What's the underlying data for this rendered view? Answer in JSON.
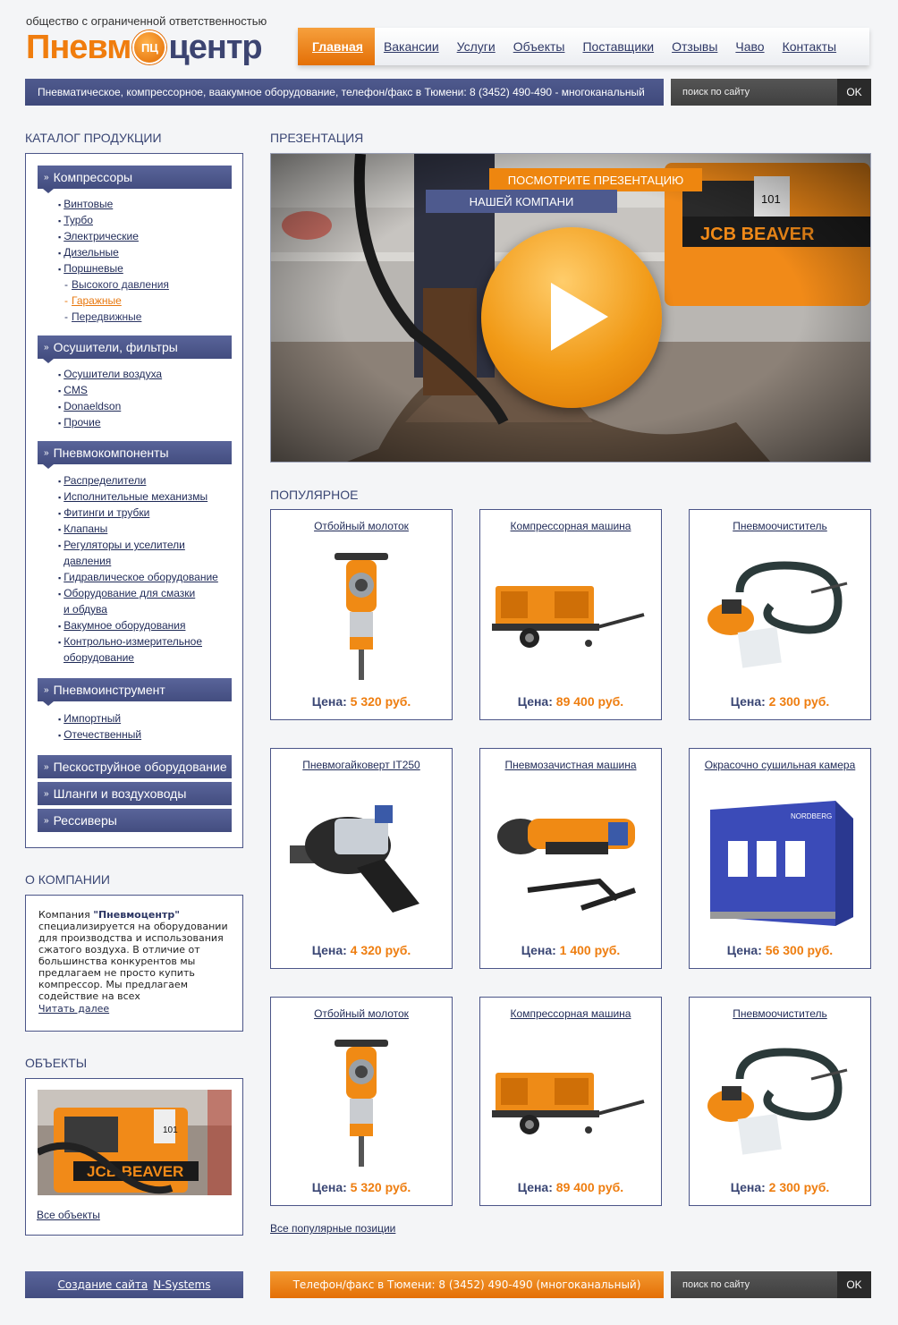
{
  "header": {
    "tagline": "общество с ограниченной ответственностью",
    "logo_left": "Пневм",
    "logo_mark": "ПЦ",
    "logo_right": "центр"
  },
  "nav": {
    "items": [
      "Главная",
      "Вакансии",
      "Услуги",
      "Объекты",
      "Поставщики",
      "Отзывы",
      "Чаво",
      "Контакты"
    ],
    "active": "Главная"
  },
  "infobar": "Пневматическое, компрессорное, ваакумное оборудование, телефон/факс в Тюмени: 8 (3452) 490-490 - многоканальный",
  "search": {
    "placeholder": "поиск по сайту",
    "button": "OK"
  },
  "catalog": {
    "title": "КАТАЛОГ ПРОДУКЦИИ",
    "groups": [
      {
        "label": "Компрессоры",
        "items": [
          "Винтовые",
          "Турбо",
          "Электрические",
          "Дизельные",
          "Поршневые"
        ],
        "subitems": [
          "Высокого давления",
          "Гаражные",
          "Передвижные"
        ]
      },
      {
        "label": "Осушители, фильтры",
        "items": [
          "Осушители воздуха",
          "CMS",
          "Donaeldson",
          "Прочие"
        ]
      },
      {
        "label": "Пневмокомпоненты",
        "items": [
          "Распределители",
          "Исполнительные механизмы",
          "Фитинги и трубки",
          "Клапаны",
          "Регуляторы и уселители",
          "давления",
          "Гидравлическое оборудование",
          "Оборудование для смазки",
          "и обдува",
          "Вакумное оборудования",
          "Контрольно-измерительное",
          "оборудование"
        ]
      },
      {
        "label": "Пневмоинструмент",
        "items": [
          "Импортный",
          "Отечественный"
        ]
      },
      {
        "label": "Пескоструйное оборудование"
      },
      {
        "label": "Шланги и воздуховоды"
      },
      {
        "label": "Рессиверы"
      }
    ]
  },
  "about": {
    "title": "О КОМПАНИИ",
    "company": "\"Пневмоцентр\"",
    "text_before": "Компания ",
    "text_after": " специализируется на оборудовании для производства и использования сжатого воздуха. В отличие от большинства конкурентов мы предлагаем не просто купить компрессор. Мы предлагаем содействие на всех",
    "more": "Читать далее"
  },
  "objects": {
    "title": "ОБЪЕКТЫ",
    "all": "Все объекты"
  },
  "presentation": {
    "title": "ПРЕЗЕНТАЦИЯ",
    "line1": "ПОСМОТРИТЕ ПРЕЗЕНТАЦИЮ",
    "line2": "НАШЕЙ КОМПАНИ"
  },
  "popular": {
    "title": "ПОПУЛЯРНОЕ",
    "price_label": "Цена:",
    "products": [
      {
        "name": "Отбойный молоток",
        "price": "5 320 руб.",
        "icon": "jackhammer-icon"
      },
      {
        "name": "Компрессорная машина",
        "price": "89 400 руб.",
        "icon": "compressor-icon"
      },
      {
        "name": "Пневмоочиститель",
        "price": "2 300 руб.",
        "icon": "sander-icon"
      },
      {
        "name": "Пневмогайковерт IT250",
        "price": "4 320 руб.",
        "icon": "impact-wrench-icon"
      },
      {
        "name": "Пневмозачистная машина",
        "price": "1 400 руб.",
        "icon": "grinder-icon"
      },
      {
        "name": "Окрасочно сушильная камера",
        "price": "56 300 руб.",
        "icon": "paint-booth-icon"
      },
      {
        "name": "Отбойный молоток",
        "price": "5 320 руб.",
        "icon": "jackhammer-icon"
      },
      {
        "name": "Компрессорная машина",
        "price": "89 400 руб.",
        "icon": "compressor-icon"
      },
      {
        "name": "Пневмоочиститель",
        "price": "2 300 руб.",
        "icon": "sander-icon"
      }
    ],
    "all_link": "Все популярные позиции"
  },
  "footer": {
    "credit_label": "Создание сайта",
    "credit_name": "N-Systems",
    "phone": "Телефон/факс в Тюмени: 8 (3452) 490-490 (многоканальный)"
  },
  "colors": {
    "accent": "#ee860f",
    "brand": "#434d80",
    "price": "#ee7d0f"
  }
}
